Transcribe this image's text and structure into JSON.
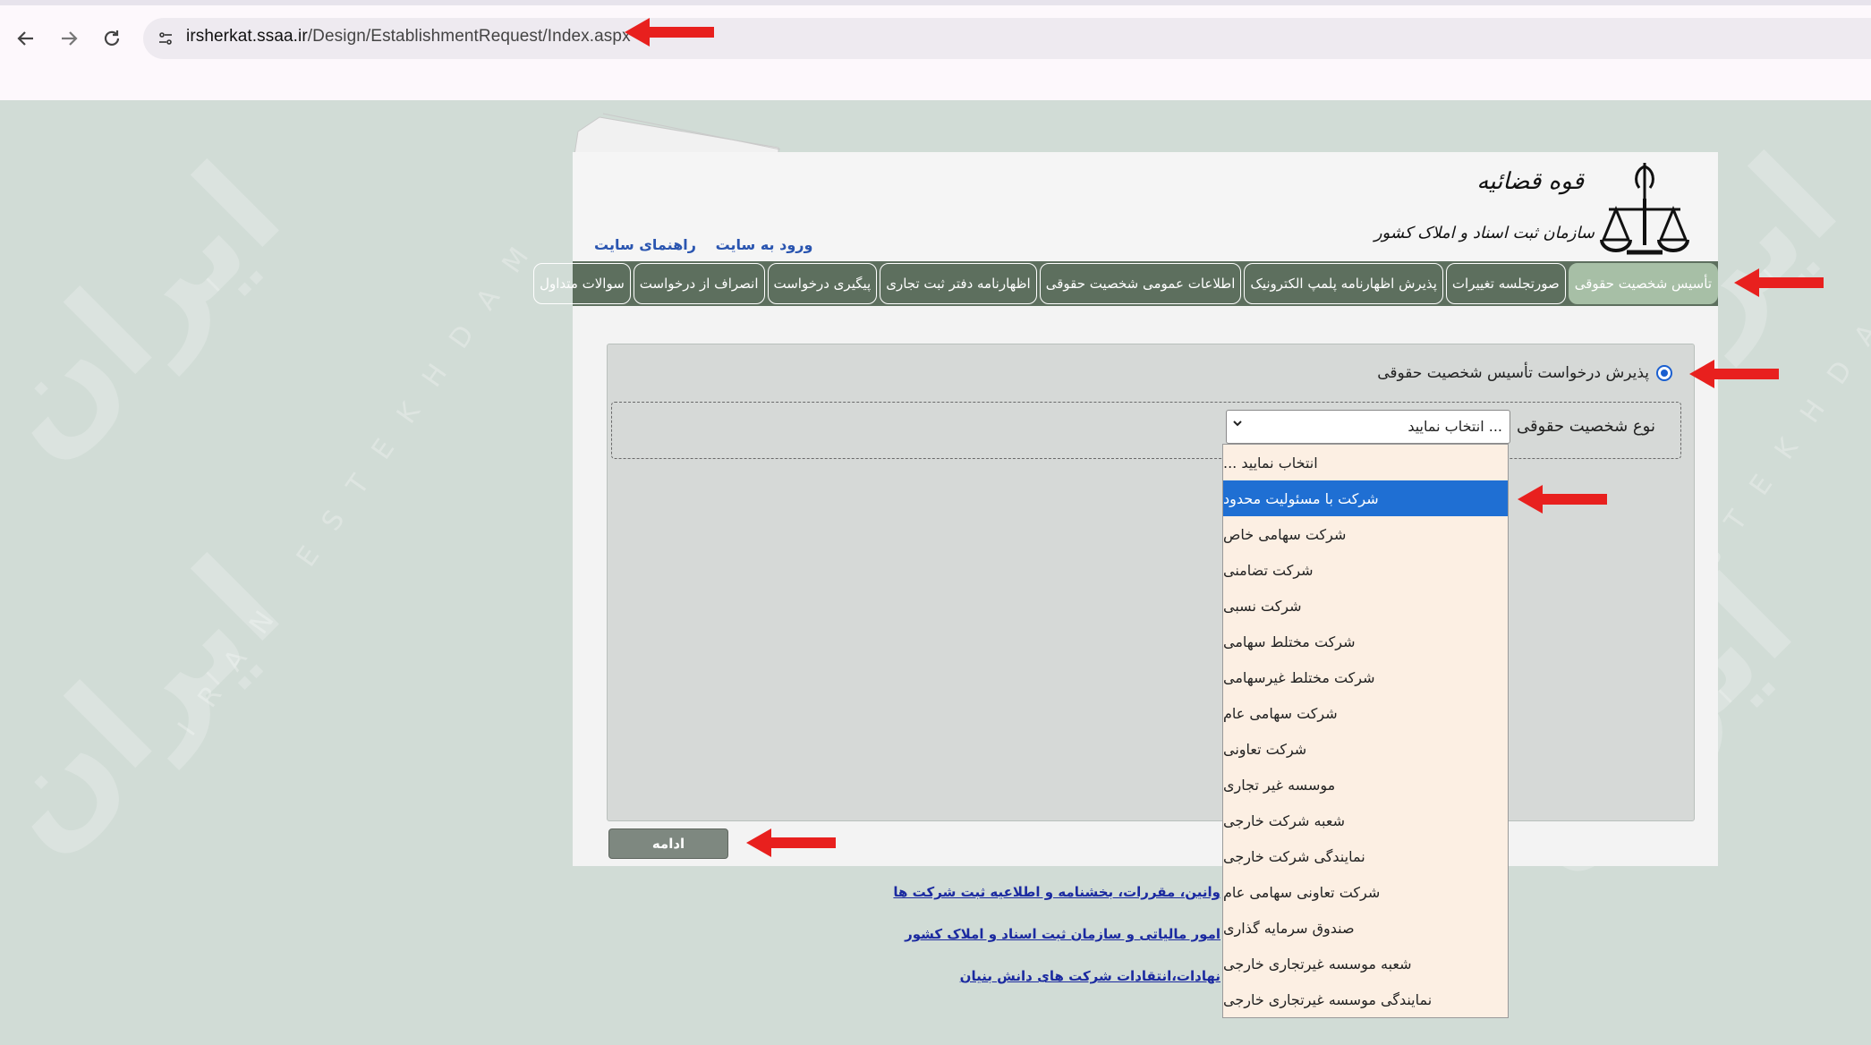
{
  "browser": {
    "url_host": "irsherkat.ssaa.ir",
    "url_path": "/Design/EstablishmentRequest/Index.aspx"
  },
  "header": {
    "org_line1": "قوه قضائیه",
    "org_line2": "سازمان ثبت اسناد و املاک کشور",
    "links": [
      "ورود به سایت",
      "راهنمای سایت"
    ]
  },
  "menu": {
    "tabs": [
      "تأسیس شخصیت حقوقی",
      "صورتجلسه تغییرات",
      "پذیرش اظهارنامه پلمپ الکترونیک",
      "اطلاعات عمومی شخصیت حقوقی",
      "اظهارنامه دفتر ثبت تجاری",
      "پیگیری درخواست",
      "انصراف از درخواست",
      "سوالات متداول"
    ]
  },
  "form": {
    "radio_label": "پذیرش درخواست تأسیس شخصیت حقوقی",
    "field_label": "نوع شخصیت حقوقی",
    "select_value": "انتخاب نمایید ...",
    "continue_label": "ادامه"
  },
  "dropdown": {
    "options": [
      "انتخاب نمایید ...",
      "شرکت با مسئولیت محدود",
      "شرکت سهامی خاص",
      "شرکت تضامنی",
      "شرکت نسبی",
      "شرکت مختلط سهامی",
      "شرکت مختلط غیرسهامی",
      "شرکت سهامی عام",
      "شرکت تعاونی",
      "موسسه غیر تجاری",
      "شعبه شرکت خارجی",
      "نمایندگی شرکت خارجی",
      "شرکت تعاونی سهامی عام",
      "صندوق سرمایه گذاری",
      "شعبه موسسه غیرتجاری خارجی",
      "نمایندگی موسسه غیرتجاری خارجی"
    ],
    "selected_index": 1
  },
  "footer_links": [
    "وانین، مقررات، بخشنامه و اطلاعیه ثبت شرکت ها",
    "امور مالیاتی و سازمان ثبت اسناد و املاک کشور",
    "نهادات،انتقادات شرکت های دانش بنیان"
  ],
  "colors": {
    "page_bg": "#d1dcd6",
    "menu_bg": "#5d6f5e",
    "menu_active": "#a7bfa6",
    "selected_option": "#1f6fd3",
    "annotation_arrow": "#e8201e"
  }
}
